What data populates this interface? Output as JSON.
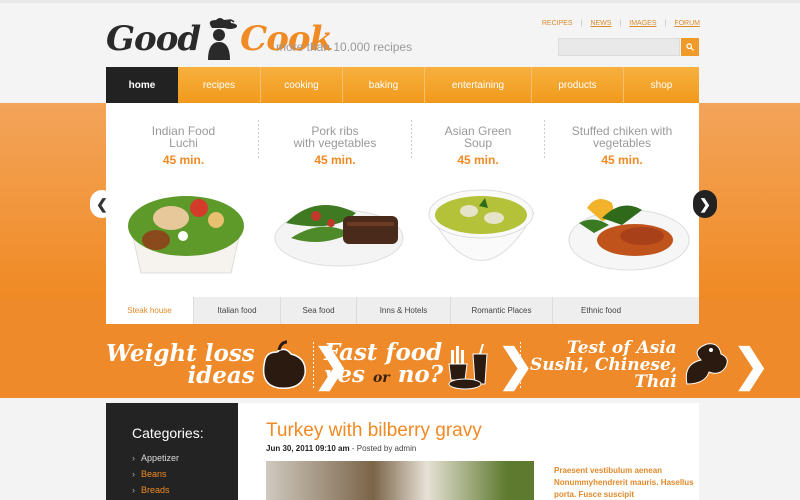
{
  "brand": {
    "logo_left": "Good",
    "logo_right": "Cook",
    "tagline": "more than 10.000 recipes"
  },
  "top_links": [
    "RECIPES",
    "NEWS",
    "IMAGES",
    "FORUM"
  ],
  "search": {
    "placeholder": ""
  },
  "nav": [
    "home",
    "recipes",
    "cooking",
    "baking",
    "entertaining",
    "products",
    "shop"
  ],
  "slides": [
    {
      "title_1": "Indian Food",
      "title_2": "Luchi",
      "time": "45 min."
    },
    {
      "title_1": "Pork ribs",
      "title_2": "with vegetables",
      "time": "45 min."
    },
    {
      "title_1": "Asian Green",
      "title_2": "Soup",
      "time": "45 min."
    },
    {
      "title_1": "Stuffed chiken with",
      "title_2": "vegetables",
      "time": "45 min."
    }
  ],
  "tabs": [
    "Steak house",
    "Italian food",
    "Sea food",
    "Inns & Hotels",
    "Romantic Places",
    "Ethnic food"
  ],
  "promos": {
    "weight_1": "Weight loss",
    "weight_2": "ideas",
    "fast_1": "Fast food",
    "fast_2a": "yes",
    "fast_2b": "or",
    "fast_2c": "no?",
    "asia_1": "Test of Asia",
    "asia_2": "Sushi, Chinese,",
    "asia_3": "Thai"
  },
  "categories": {
    "title": "Categories:",
    "items": [
      "Appetizer",
      "Beans",
      "Breads"
    ]
  },
  "article": {
    "title": "Turkey with bilberry gravy",
    "date": "Jun 30, 2011 09:10 am",
    "posted_by": " - Posted by admin",
    "excerpt": "Praesent vestibulum aenean Nonummyhendrerit mauris. Hasellus porta. Fusce suscipit"
  },
  "colors": {
    "accent": "#f08a24",
    "dark": "#232323"
  }
}
